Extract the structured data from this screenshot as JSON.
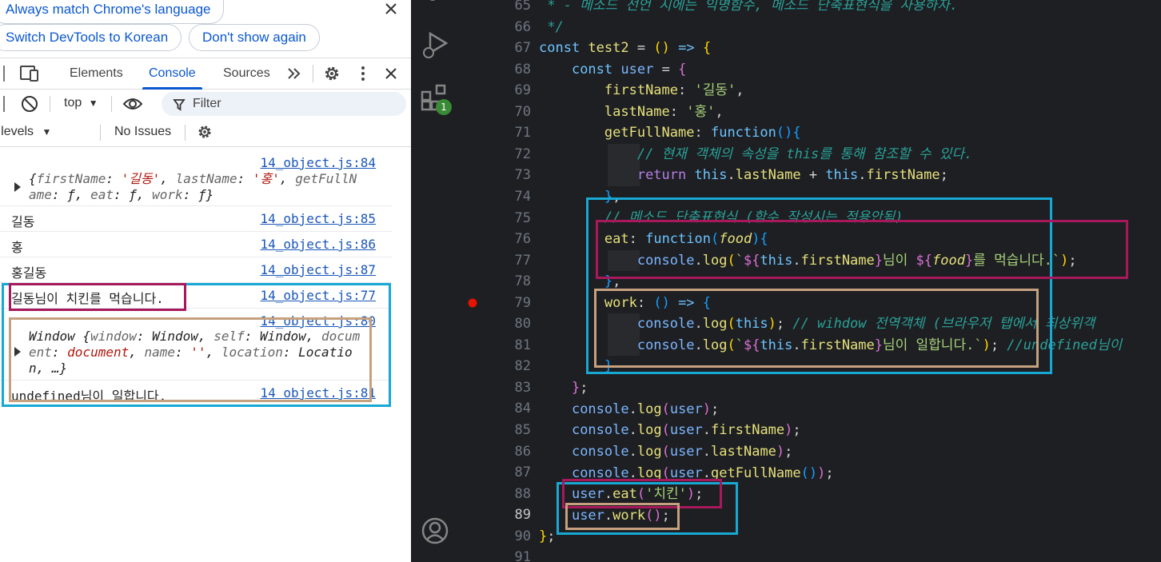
{
  "devtools": {
    "banner": {
      "match_language": "Always match Chrome's language",
      "switch_korean": "Switch DevTools to Korean",
      "dont_show": "Don't show again"
    },
    "tabs": {
      "elements": "Elements",
      "console": "Console",
      "sources": "Sources"
    },
    "toolbar": {
      "context": "top",
      "filter_placeholder": "Filter",
      "levels": "Default levels",
      "issues": "No Issues"
    },
    "console": [
      {
        "text": "",
        "src": "14_object.js:84"
      },
      {
        "text": "길동",
        "src": "14_object.js:85"
      },
      {
        "text": "홍",
        "src": "14_object.js:86"
      },
      {
        "text": "홍길동",
        "src": "14_object.js:87"
      },
      {
        "text": "길동님이 치킨를 먹습니다.",
        "src": "14_object.js:77"
      },
      {
        "text": "",
        "src": "14_object.js:80"
      },
      {
        "text": "undefined님이 일합니다.",
        "src": "14_object.js:81"
      }
    ]
  },
  "editor": {
    "line_numbers": [
      "65",
      "66",
      "67",
      "68",
      "69",
      "70",
      "71",
      "72",
      "73",
      "74",
      "75",
      "76",
      "77",
      "78",
      "79",
      "80",
      "81",
      "82",
      "83",
      "84",
      "85",
      "86",
      "87",
      "88",
      "89",
      "90",
      "91"
    ],
    "current_line": "89",
    "extensions_badge": "1",
    "comments": {
      "l65": " * - 메소드 선언 시에는 익명함수, 메소드 단축표현식을 사용하자.",
      "l72": "// 현재 객체의 속성을 this를 통해 참조할 수 있다.",
      "l75": "// 메소드 단축표현식 (함수 작성시는 적용안됨)",
      "l80": "// wihdow 전역객체 (브라우저 탭에서 최상위객",
      "l81": "//undefined님이"
    }
  }
}
